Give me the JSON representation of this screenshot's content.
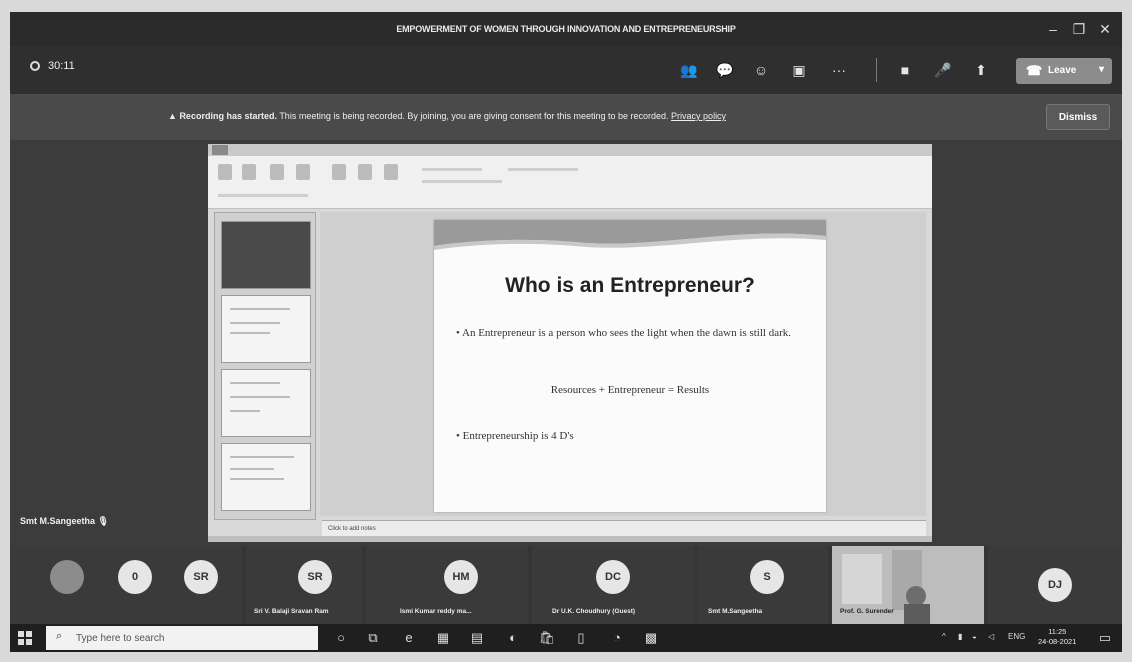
{
  "window": {
    "title": "EMPOWERMENT OF WOMEN THROUGH INNOVATION AND ENTREPRENEURSHIP"
  },
  "toolbar": {
    "timer": "30:11",
    "leave_label": "Leave"
  },
  "banner": {
    "bold_text": "Recording has started.",
    "text": "This meeting is being recorded. By joining, you are giving consent for this meeting to be recorded.",
    "link": "Privacy policy",
    "dismiss_label": "Dismiss"
  },
  "stage": {
    "presenter_name": "Smt M.Sangeetha"
  },
  "slide": {
    "title": "Who is an Entrepreneur?",
    "bullet1": "• An Entrepreneur is a person who sees the light when the dawn is still dark.",
    "equation": "Resources + Entrepreneur = Results",
    "bullet2": "• Entrepreneurship is 4 D's"
  },
  "ppt": {
    "notes_placeholder": "Click to add notes"
  },
  "participants": [
    {
      "initials": "",
      "name": ""
    },
    {
      "initials": "0",
      "name": ""
    },
    {
      "initials": "SR",
      "name": ""
    },
    {
      "initials": "SR",
      "name": "Sri V. Balaji Sravan Ram"
    },
    {
      "initials": "HM",
      "name": "Ismi Kumar reddy ma..."
    },
    {
      "initials": "DC",
      "name": "Dr U.K. Choudhury (Guest)"
    },
    {
      "initials": "S",
      "name": "Smt M.Sangeetha"
    },
    {
      "initials": "",
      "name": "Prof. G. Surender"
    },
    {
      "initials": "DJ",
      "name": ""
    }
  ],
  "taskbar": {
    "search_placeholder": "Type here to search",
    "lang": "ENG",
    "time": "11:25",
    "date": "24-08-2021"
  },
  "colors": {
    "accent": "#8c8c8c",
    "background": "#3a3a3a"
  }
}
